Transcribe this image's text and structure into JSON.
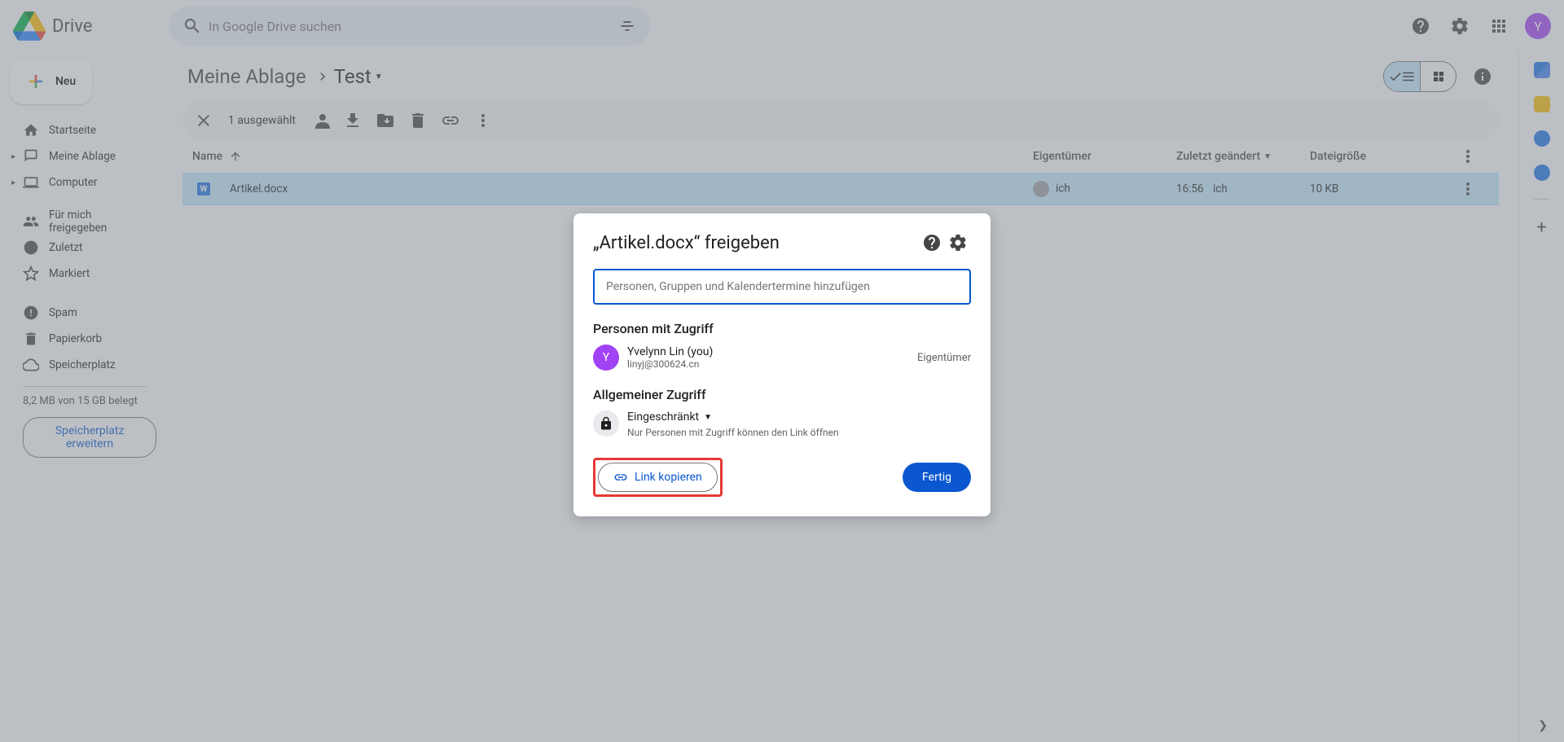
{
  "app": {
    "name": "Drive",
    "avatar_initial": "Y"
  },
  "search": {
    "placeholder": "In Google Drive suchen"
  },
  "newButton": "Neu",
  "nav": {
    "home": "Startseite",
    "myDrive": "Meine Ablage",
    "computer": "Computer",
    "shared": "Für mich freigegeben",
    "recent": "Zuletzt",
    "starred": "Markiert",
    "spam": "Spam",
    "trash": "Papierkorb",
    "storage": "Speicherplatz"
  },
  "storage": {
    "usage": "8,2 MB von 15 GB belegt",
    "cta": "Speicherplatz erweitern"
  },
  "breadcrumb": {
    "root": "Meine Ablage",
    "current": "Test"
  },
  "selection": {
    "count": "1 ausgewählt"
  },
  "columns": {
    "name": "Name",
    "owner": "Eigentümer",
    "modified": "Zuletzt geändert",
    "size": "Dateigröße"
  },
  "row": {
    "name": "Artikel.docx",
    "owner": "ich",
    "modifiedTime": "16:56",
    "modifiedBy": "ich",
    "size": "10 KB"
  },
  "dialog": {
    "title": "„Artikel.docx“ freigeben",
    "inputPlaceholder": "Personen, Gruppen und Kalendertermine hinzufügen",
    "peopleSection": "Personen mit Zugriff",
    "person": {
      "initial": "Y",
      "name": "Yvelynn Lin (you)",
      "email": "linyj@300624.cn",
      "role": "Eigentümer"
    },
    "generalSection": "Allgemeiner Zugriff",
    "accessLevel": "Eingeschränkt",
    "accessNote": "Nur Personen mit Zugriff können den Link öffnen",
    "copyLink": "Link kopieren",
    "done": "Fertig"
  }
}
